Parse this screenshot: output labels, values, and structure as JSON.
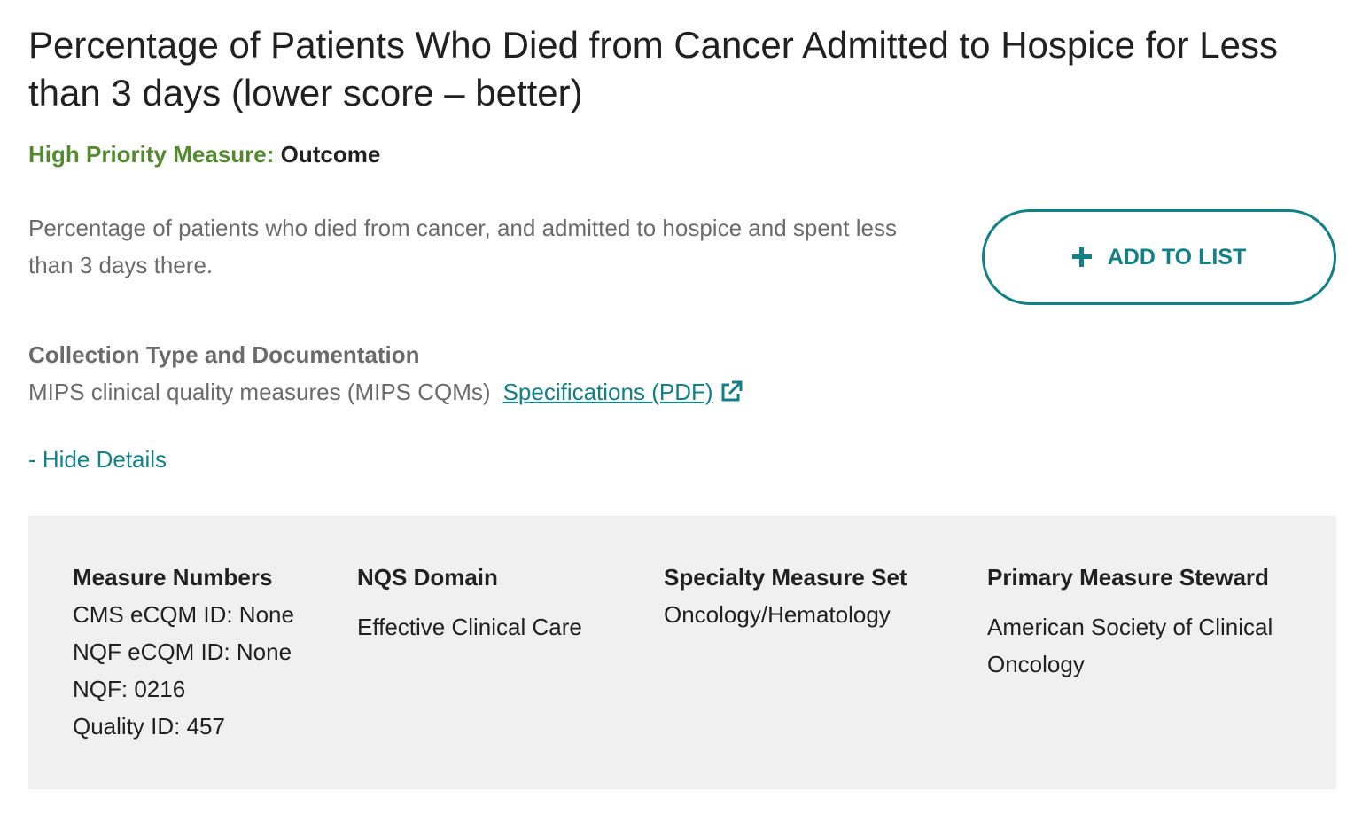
{
  "title": "Percentage of Patients Who Died from Cancer Admitted to Hospice for Less than 3 days (lower score – better)",
  "priority": {
    "label": "High Priority Measure:",
    "value": "Outcome"
  },
  "description": "Percentage of patients who died from cancer, and admitted to hospice and spent less than 3 days there.",
  "add_button": {
    "label": "ADD TO LIST",
    "icon": "plus-icon"
  },
  "collection": {
    "heading": "Collection Type and Documentation",
    "type": "MIPS clinical quality measures (MIPS CQMs)",
    "link_label": "Specifications (PDF)",
    "link_icon": "external-link-icon"
  },
  "toggle_details": "- Hide Details",
  "details": {
    "measure_numbers": {
      "heading": "Measure Numbers",
      "lines": [
        "CMS eCQM ID: None",
        "NQF eCQM ID: None",
        "NQF: 0216",
        "Quality ID: 457"
      ]
    },
    "nqs_domain": {
      "heading": "NQS Domain",
      "value": "Effective Clinical Care"
    },
    "specialty": {
      "heading": "Specialty Measure Set",
      "value": "Oncology/Hematology"
    },
    "steward": {
      "heading": "Primary Measure Steward",
      "value": "American Society of Clinical Oncology"
    }
  },
  "colors": {
    "accent": "#118087",
    "priority_green": "#558b2f",
    "panel_bg": "#f0f0f0",
    "muted_text": "#6b6b6b"
  }
}
